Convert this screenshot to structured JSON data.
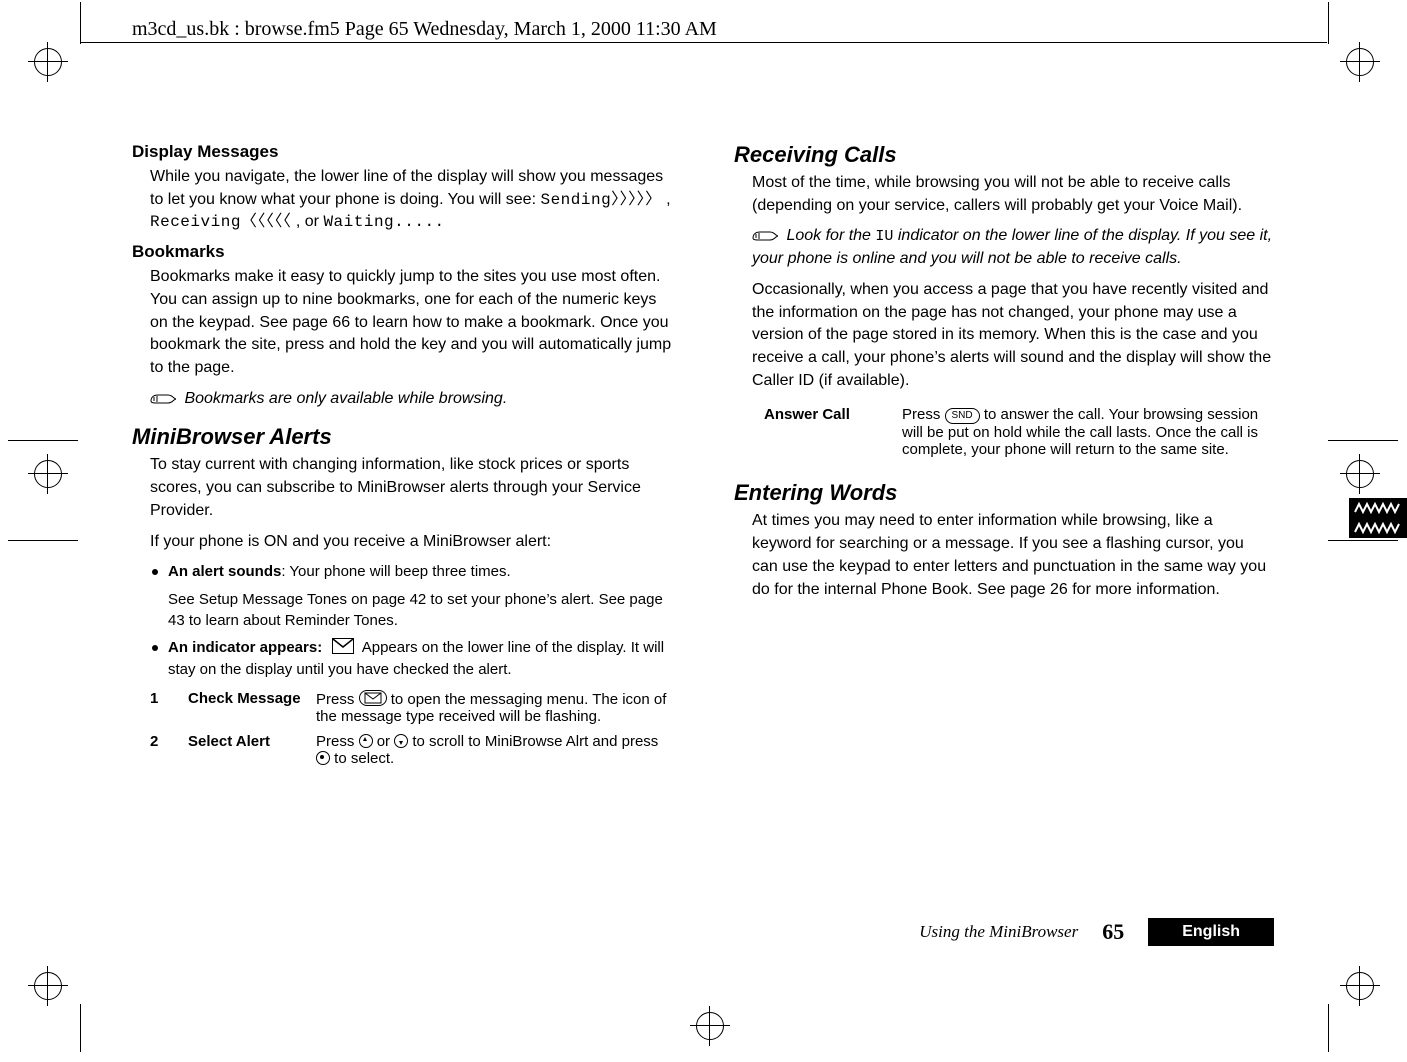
{
  "runhead": "m3cd_us.bk : browse.fm5  Page 65  Wednesday, March 1, 2000  11:30 AM",
  "left": {
    "h_display_messages": "Display Messages",
    "p_display_messages_1": "While you navigate, the lower line of the display will show you messages to let you know what your phone is doing. You will see: ",
    "mono_sending": "Sending〉〉〉〉〉",
    "comma1": ", ",
    "mono_receiving": "Receiving〈〈〈〈〈",
    "comma2": ", or ",
    "mono_waiting": "Waiting.....",
    "h_bookmarks": "Bookmarks",
    "p_bookmarks": "Bookmarks make it easy to quickly jump to the sites you use most often. You can assign up to nine bookmarks, one for each of the numeric keys on the keypad. See page 66 to learn how to make a bookmark. Once you bookmark the site, press and hold the key and you will automatically jump to the page.",
    "note_bookmarks": "Bookmarks are only available while browsing.",
    "h_section_alerts": "MiniBrowser Alerts",
    "p_alerts_1": "To stay current with changing information, like stock prices or sports scores, you can subscribe to MiniBrowser alerts through your Service Provider.",
    "p_alerts_2": "If your phone is ON and you receive a MiniBrowser alert:",
    "bul1_strong": "An alert sounds",
    "bul1_rest": ": Your phone will beep three times.",
    "bul1_sub": "See Setup Message Tones on page 42 to set your phone’s alert. See page 43 to learn about Reminder Tones.",
    "bul2_strong": "An indicator appears:",
    "bul2_rest_a": " Appears on the lower line of the display. It will stay on the display until you have checked the alert.",
    "step1_num": "1",
    "step1_label": "Check Message",
    "step1_text_a": "Press ",
    "step1_text_b": " to open the messaging menu. The icon of the message type received will be flashing.",
    "step2_num": "2",
    "step2_label": "Select Alert",
    "step2_text_a": "Press ",
    "step2_text_mid": " or ",
    "step2_text_b": " to scroll to MiniBrowse Alrt and press ",
    "step2_text_c": " to select."
  },
  "right": {
    "h_section_receiving": "Receiving Calls",
    "p_recv_1": "Most of the time, while browsing you will not be able to receive calls (depending on your service, callers will probably get your Voice Mail).",
    "note_recv_pre": "Look for the ",
    "note_recv_iu": "IU",
    "note_recv_post": " indicator on the lower line of the display. If you see it, your phone is online and you will not be able to receive calls.",
    "p_recv_2": "Occasionally, when you access a page that you have recently visited and the information on the page has not changed, your phone may use a version of the page stored in its memory. When this is the case and you receive a call, your phone’s alerts will sound and the display will show the Caller ID (if available).",
    "def_term": "Answer Call",
    "def_text_a": "Press ",
    "def_btn": "SND",
    "def_text_b": " to answer the call. Your browsing session will be put on hold while the call lasts. Once the call is complete, your phone will return to the same site.",
    "h_section_words": "Entering Words",
    "p_words": "At times you may need to enter information while browsing, like a keyword for searching or a message. If you see a flashing cursor, you can use the keypad to enter letters and punctuation in the same way you do for the internal Phone Book. See page 26 for more information."
  },
  "footer": {
    "title": "Using the MiniBrowser",
    "page": "65",
    "lang": "English"
  }
}
